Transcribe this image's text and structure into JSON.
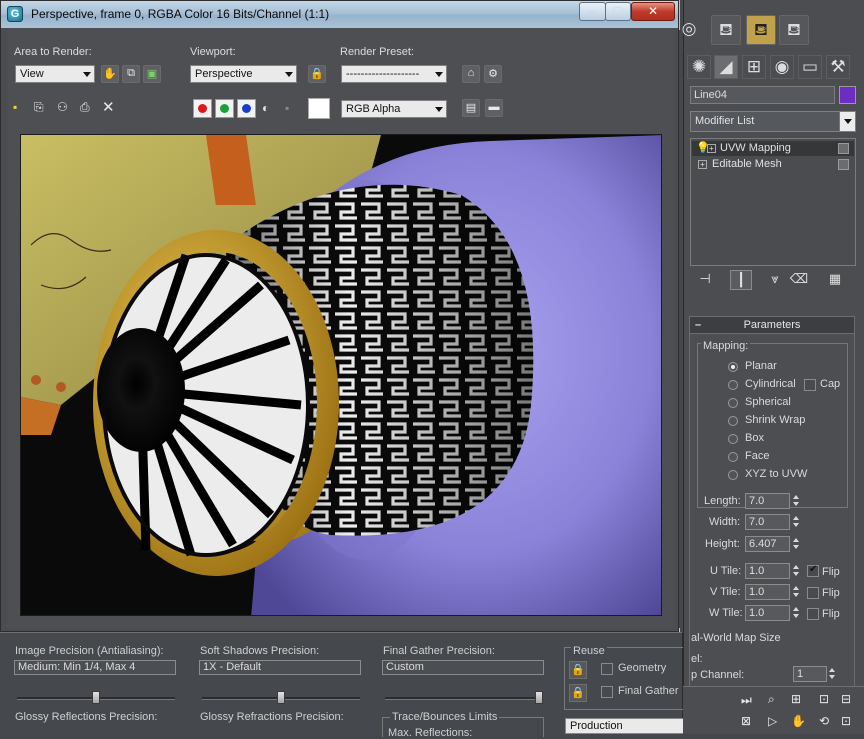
{
  "render_window": {
    "title": "Perspective, frame 0, RGBA Color 16 Bits/Channel (1:1)",
    "app_icon": "G",
    "area_to_render_label": "Area to Render:",
    "area_to_render_value": "View",
    "viewport_label": "Viewport:",
    "viewport_value": "Perspective",
    "render_preset_label": "Render Preset:",
    "render_preset_value": "--------------------",
    "channel_display_value": "RGB Alpha",
    "channel_colors": {
      "red": "#e01818",
      "green": "#17a33a",
      "blue": "#1a3ecb"
    }
  },
  "render_setup": {
    "image_precision_label": "Image Precision (Antialiasing):",
    "image_precision_value": "Medium: Min 1/4, Max 4",
    "soft_shadows_label": "Soft Shadows Precision:",
    "soft_shadows_value": "1X - Default",
    "final_gather_label": "Final Gather Precision:",
    "final_gather_value": "Custom",
    "reuse_label": "Reuse",
    "geometry_label": "Geometry",
    "final_gather_check_label": "Final Gather",
    "glossy_reflections_label": "Glossy Reflections Precision:",
    "glossy_refractions_label": "Glossy Refractions Precision:",
    "trace_bounces_label": "Trace/Bounces Limits",
    "max_reflections_label": "Max. Reflections:",
    "production_value": "Production",
    "image_precision_slider": 0.5,
    "soft_shadows_slider": 0.5,
    "final_gather_slider": 1.0
  },
  "command_panel": {
    "object_name": "Line04",
    "object_color": "#6b2ec1",
    "modifier_list_label": "Modifier List",
    "stack": [
      {
        "label": "UVW Mapping",
        "selected": true
      },
      {
        "label": "Editable Mesh",
        "selected": false
      }
    ],
    "parameters_title": "Parameters",
    "mapping_label": "Mapping:",
    "mapping_options": [
      "Planar",
      "Cylindrical",
      "Spherical",
      "Shrink Wrap",
      "Box",
      "Face",
      "XYZ to UVW"
    ],
    "mapping_selected": "Planar",
    "cap_label": "Cap",
    "length_label": "Length:",
    "length_value": "7.0",
    "width_label": "Width:",
    "width_value": "7.0",
    "height_label": "Height:",
    "height_value": "6.407",
    "u_tile_label": "U Tile:",
    "u_tile_value": "1.0",
    "v_tile_label": "V Tile:",
    "v_tile_value": "1.0",
    "w_tile_label": "W Tile:",
    "w_tile_value": "1.0",
    "flip_label": "Flip",
    "u_flip_checked": true,
    "real_world_label": "al-World Map Size",
    "channel_label": "el:",
    "map_channel_label": "p Channel:",
    "map_channel_value": "1"
  }
}
